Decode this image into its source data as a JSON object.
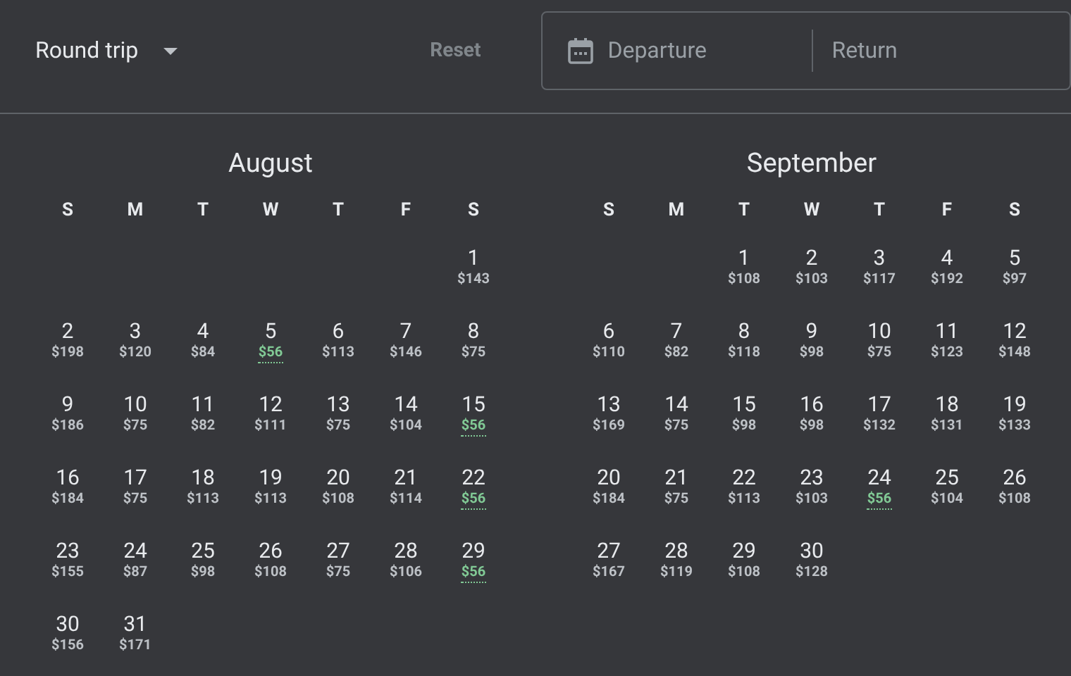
{
  "trip_type": {
    "label": "Round trip"
  },
  "reset_button": {
    "label": "Reset",
    "disabled": true
  },
  "date_fields": {
    "departure": {
      "placeholder": "Departure"
    },
    "return": {
      "placeholder": "Return"
    }
  },
  "months": [
    {
      "title": "August",
      "weekdays": [
        "S",
        "M",
        "T",
        "W",
        "T",
        "F",
        "S"
      ],
      "weeks": [
        {
          "right_aligned": true,
          "days": [
            {
              "day": "1",
              "price": "$143",
              "lowest": false
            }
          ]
        },
        [
          {
            "day": "2",
            "price": "$198",
            "lowest": false
          },
          {
            "day": "3",
            "price": "$120",
            "lowest": false
          },
          {
            "day": "4",
            "price": "$84",
            "lowest": false
          },
          {
            "day": "5",
            "price": "$56",
            "lowest": true
          },
          {
            "day": "6",
            "price": "$113",
            "lowest": false
          },
          {
            "day": "7",
            "price": "$146",
            "lowest": false
          },
          {
            "day": "8",
            "price": "$75",
            "lowest": false
          }
        ],
        [
          {
            "day": "9",
            "price": "$186",
            "lowest": false
          },
          {
            "day": "10",
            "price": "$75",
            "lowest": false
          },
          {
            "day": "11",
            "price": "$82",
            "lowest": false
          },
          {
            "day": "12",
            "price": "$111",
            "lowest": false
          },
          {
            "day": "13",
            "price": "$75",
            "lowest": false
          },
          {
            "day": "14",
            "price": "$104",
            "lowest": false
          },
          {
            "day": "15",
            "price": "$56",
            "lowest": true
          }
        ],
        [
          {
            "day": "16",
            "price": "$184",
            "lowest": false
          },
          {
            "day": "17",
            "price": "$75",
            "lowest": false
          },
          {
            "day": "18",
            "price": "$113",
            "lowest": false
          },
          {
            "day": "19",
            "price": "$113",
            "lowest": false
          },
          {
            "day": "20",
            "price": "$108",
            "lowest": false
          },
          {
            "day": "21",
            "price": "$114",
            "lowest": false
          },
          {
            "day": "22",
            "price": "$56",
            "lowest": true
          }
        ],
        [
          {
            "day": "23",
            "price": "$155",
            "lowest": false
          },
          {
            "day": "24",
            "price": "$87",
            "lowest": false
          },
          {
            "day": "25",
            "price": "$98",
            "lowest": false
          },
          {
            "day": "26",
            "price": "$108",
            "lowest": false
          },
          {
            "day": "27",
            "price": "$75",
            "lowest": false
          },
          {
            "day": "28",
            "price": "$106",
            "lowest": false
          },
          {
            "day": "29",
            "price": "$56",
            "lowest": true
          }
        ],
        [
          {
            "day": "30",
            "price": "$156",
            "lowest": false
          },
          {
            "day": "31",
            "price": "$171",
            "lowest": false
          }
        ]
      ]
    },
    {
      "title": "September",
      "weekdays": [
        "S",
        "M",
        "T",
        "W",
        "T",
        "F",
        "S"
      ],
      "weeks": [
        {
          "right_aligned": true,
          "days": [
            {
              "day": "1",
              "price": "$108",
              "lowest": false
            },
            {
              "day": "2",
              "price": "$103",
              "lowest": false
            },
            {
              "day": "3",
              "price": "$117",
              "lowest": false
            },
            {
              "day": "4",
              "price": "$192",
              "lowest": false
            },
            {
              "day": "5",
              "price": "$97",
              "lowest": false
            }
          ]
        },
        [
          {
            "day": "6",
            "price": "$110",
            "lowest": false
          },
          {
            "day": "7",
            "price": "$82",
            "lowest": false
          },
          {
            "day": "8",
            "price": "$118",
            "lowest": false
          },
          {
            "day": "9",
            "price": "$98",
            "lowest": false
          },
          {
            "day": "10",
            "price": "$75",
            "lowest": false
          },
          {
            "day": "11",
            "price": "$123",
            "lowest": false
          },
          {
            "day": "12",
            "price": "$148",
            "lowest": false
          }
        ],
        [
          {
            "day": "13",
            "price": "$169",
            "lowest": false
          },
          {
            "day": "14",
            "price": "$75",
            "lowest": false
          },
          {
            "day": "15",
            "price": "$98",
            "lowest": false
          },
          {
            "day": "16",
            "price": "$98",
            "lowest": false
          },
          {
            "day": "17",
            "price": "$132",
            "lowest": false
          },
          {
            "day": "18",
            "price": "$131",
            "lowest": false
          },
          {
            "day": "19",
            "price": "$133",
            "lowest": false
          }
        ],
        [
          {
            "day": "20",
            "price": "$184",
            "lowest": false
          },
          {
            "day": "21",
            "price": "$75",
            "lowest": false
          },
          {
            "day": "22",
            "price": "$113",
            "lowest": false
          },
          {
            "day": "23",
            "price": "$103",
            "lowest": false
          },
          {
            "day": "24",
            "price": "$56",
            "lowest": true
          },
          {
            "day": "25",
            "price": "$104",
            "lowest": false
          },
          {
            "day": "26",
            "price": "$108",
            "lowest": false
          }
        ],
        [
          {
            "day": "27",
            "price": "$167",
            "lowest": false
          },
          {
            "day": "28",
            "price": "$119",
            "lowest": false
          },
          {
            "day": "29",
            "price": "$108",
            "lowest": false
          },
          {
            "day": "30",
            "price": "$128",
            "lowest": false
          }
        ]
      ]
    }
  ]
}
